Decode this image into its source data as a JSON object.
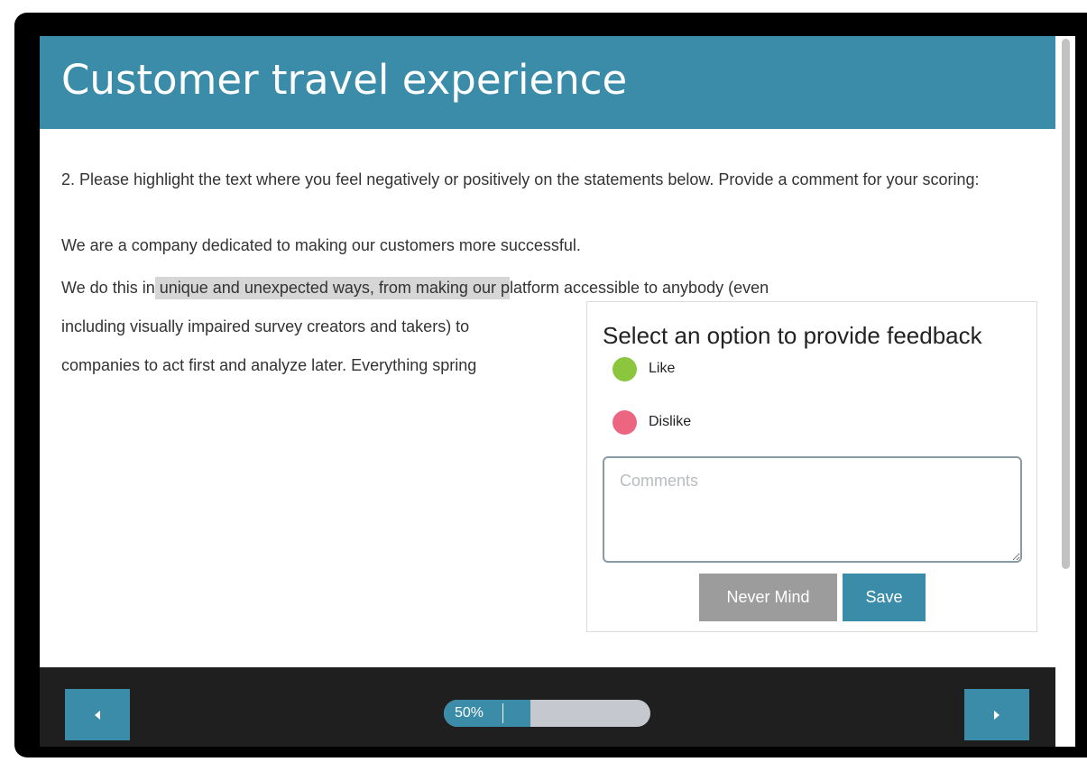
{
  "survey": {
    "title": "Customer travel experience"
  },
  "question": {
    "text": "2. Please highlight the text where you feel negatively or positively on the statements below. Provide a comment for your scoring:",
    "statements": [
      {
        "before": "We are a company dedicated to making our customers more successful.",
        "highlight": "",
        "after": ""
      },
      {
        "before": "We do this in",
        "highlight": " unique and unexpected ways, from making our p",
        "after": "latform accessible to anybody (even"
      },
      {
        "before": "including visually impaired survey creators and takers) to",
        "highlight": "",
        "after": ""
      },
      {
        "before": "companies to act first and analyze later. Everything spring",
        "highlight": "",
        "after": ""
      }
    ]
  },
  "feedback": {
    "title": "Select an option to provide feedback",
    "options": [
      {
        "label": "Like",
        "color": "#8cc63f"
      },
      {
        "label": "Dislike",
        "color": "#ec6581"
      }
    ],
    "comments_placeholder": "Comments",
    "comments_value": "",
    "cancel_label": "Never Mind",
    "save_label": "Save"
  },
  "footer": {
    "progress_label": "50%",
    "progress": 0.5,
    "prev_icon": "caret-left-icon",
    "next_icon": "caret-right-icon"
  },
  "colors": {
    "accent": "#3a8ca8",
    "cancel": "#9c9c9c",
    "footer": "#1f1f1f"
  }
}
